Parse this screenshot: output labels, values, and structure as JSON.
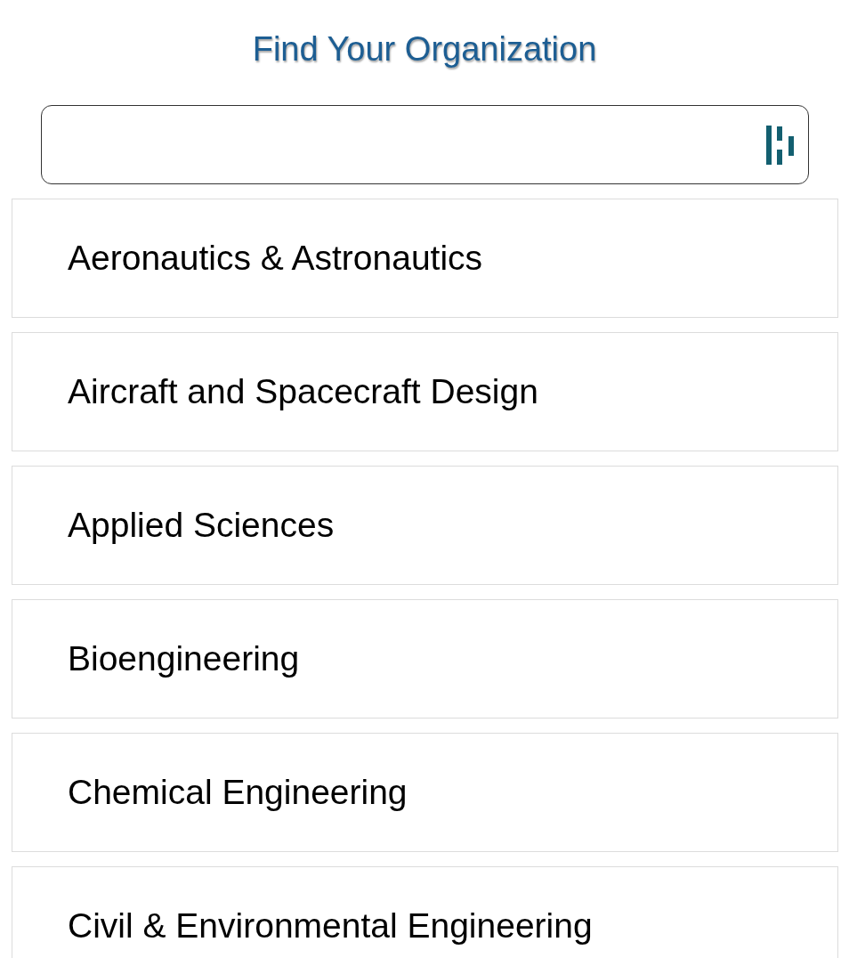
{
  "title": "Find Your Organization",
  "organizations": [
    {
      "name": "Aeronautics & Astronautics"
    },
    {
      "name": "Aircraft and Spacecraft Design"
    },
    {
      "name": "Applied Sciences"
    },
    {
      "name": "Bioengineering"
    },
    {
      "name": "Chemical Engineering"
    },
    {
      "name": "Civil & Environmental Engineering"
    }
  ]
}
